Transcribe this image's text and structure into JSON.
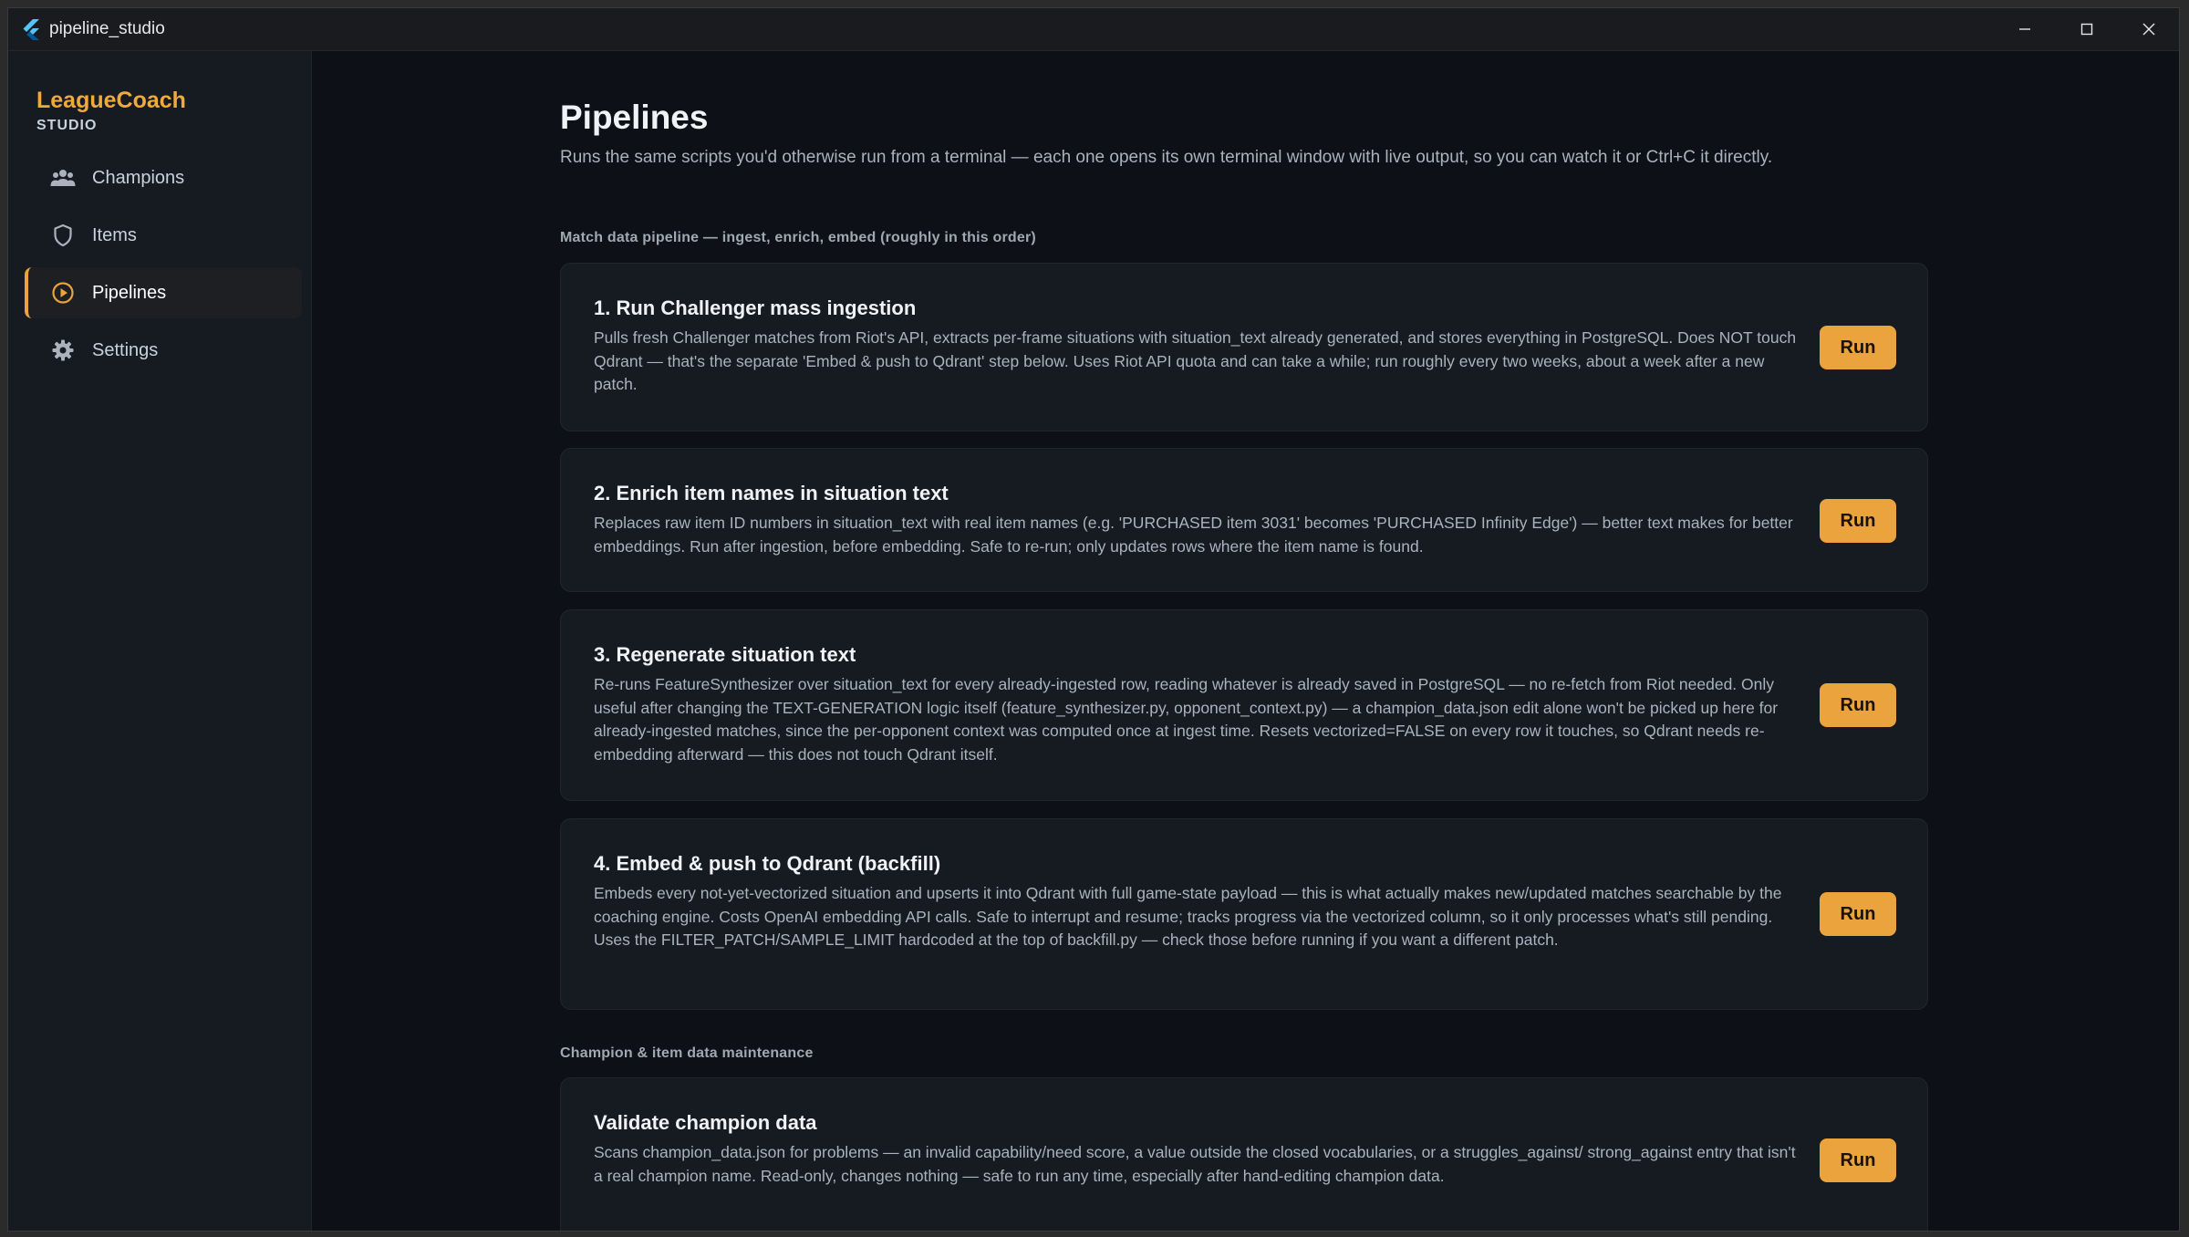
{
  "window": {
    "title": "pipeline_studio"
  },
  "sidebar": {
    "brand_name": "LeagueCoach",
    "brand_sub": "STUDIO",
    "items": [
      {
        "label": "Champions",
        "icon": "people-icon"
      },
      {
        "label": "Items",
        "icon": "shield-icon"
      },
      {
        "label": "Pipelines",
        "icon": "play-circle-icon",
        "active": true
      },
      {
        "label": "Settings",
        "icon": "gear-icon"
      }
    ]
  },
  "main": {
    "title": "Pipelines",
    "description": "Runs the same scripts you'd otherwise run from a terminal — each one opens its own terminal window with live output, so you can watch it or Ctrl+C it directly.",
    "sections": [
      {
        "label": "Match data pipeline — ingest, enrich, embed (roughly in this order)",
        "cards": [
          {
            "title": "1. Run Challenger mass ingestion",
            "description": "Pulls fresh Challenger matches from Riot's API, extracts per-frame situations with situation_text already generated, and stores everything in PostgreSQL. Does NOT touch Qdrant — that's the separate 'Embed & push to Qdrant' step below. Uses Riot API quota and can take a while; run roughly every two weeks, about a week after a new patch.",
            "button": "Run"
          },
          {
            "title": "2. Enrich item names in situation text",
            "description": "Replaces raw item ID numbers in situation_text with real item names (e.g. 'PURCHASED item 3031' becomes 'PURCHASED Infinity Edge') — better text makes for better embeddings. Run after ingestion, before embedding. Safe to re-run; only updates rows where the item name is found.",
            "button": "Run"
          },
          {
            "title": "3. Regenerate situation text",
            "description": "Re-runs FeatureSynthesizer over situation_text for every already-ingested row, reading whatever is already saved in PostgreSQL — no re-fetch from Riot needed. Only useful after changing the TEXT-GENERATION logic itself (feature_synthesizer.py, opponent_context.py) — a champion_data.json edit alone won't be picked up here for already-ingested matches, since the per-opponent context was computed once at ingest time. Resets vectorized=FALSE on every row it touches, so Qdrant needs re-embedding afterward — this does not touch Qdrant itself.",
            "button": "Run"
          },
          {
            "title": "4. Embed & push to Qdrant (backfill)",
            "description": "Embeds every not-yet-vectorized situation and upserts it into Qdrant with full game-state payload — this is what actually makes new/updated matches searchable by the coaching engine. Costs OpenAI embedding API calls. Safe to interrupt and resume; tracks progress via the vectorized column, so it only processes what's still pending. Uses the FILTER_PATCH/SAMPLE_LIMIT hardcoded at the top of backfill.py — check those before running if you want a different patch.",
            "button": "Run"
          }
        ]
      },
      {
        "label": "Champion & item data maintenance",
        "cards": [
          {
            "title": "Validate champion data",
            "description": "Scans champion_data.json for problems — an invalid capability/need score, a value outside the closed vocabularies, or a struggles_against/ strong_against entry that isn't a real champion name. Read-only, changes nothing — safe to run any time, especially after hand-editing champion data.",
            "button": "Run"
          }
        ]
      }
    ]
  },
  "colors": {
    "accent": "#eba43d",
    "background": "#0d1117",
    "sidebar": "#161b22",
    "card": "#161b22"
  }
}
